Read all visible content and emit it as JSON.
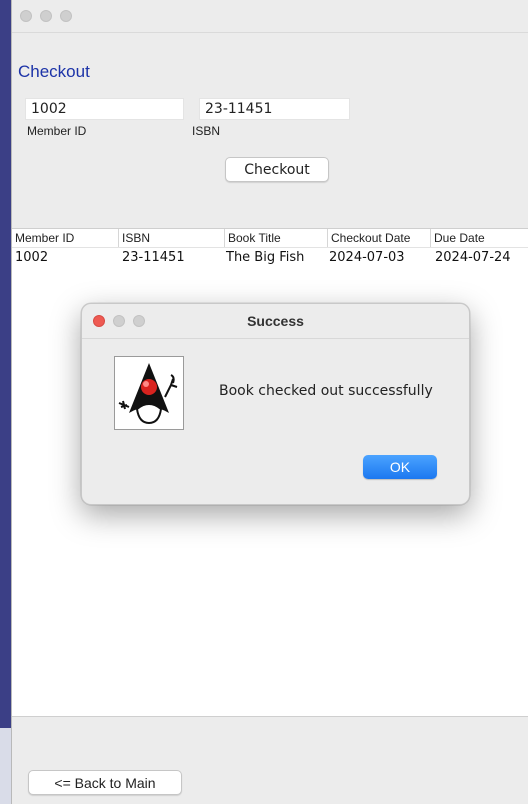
{
  "window": {
    "heading": "Checkout",
    "member_id_value": "1002",
    "isbn_value": "23-11451",
    "member_id_label": "Member ID",
    "isbn_label": "ISBN",
    "checkout_button": "Checkout",
    "back_button": "<= Back to Main"
  },
  "table": {
    "columns": [
      "Member ID",
      "ISBN",
      "Book Title",
      "Checkout Date",
      "Due Date"
    ],
    "rows": [
      [
        "1002",
        "23-11451",
        "The Big Fish",
        "2024-07-03",
        "2024-07-24"
      ]
    ]
  },
  "dialog": {
    "title": "Success",
    "message": "Book checked out successfully",
    "ok_button": "OK",
    "icon": "java-duke-icon"
  },
  "colors": {
    "heading": "#1c33a8",
    "ok_button": "#2a85f7",
    "close_light": "#ee5a52"
  }
}
